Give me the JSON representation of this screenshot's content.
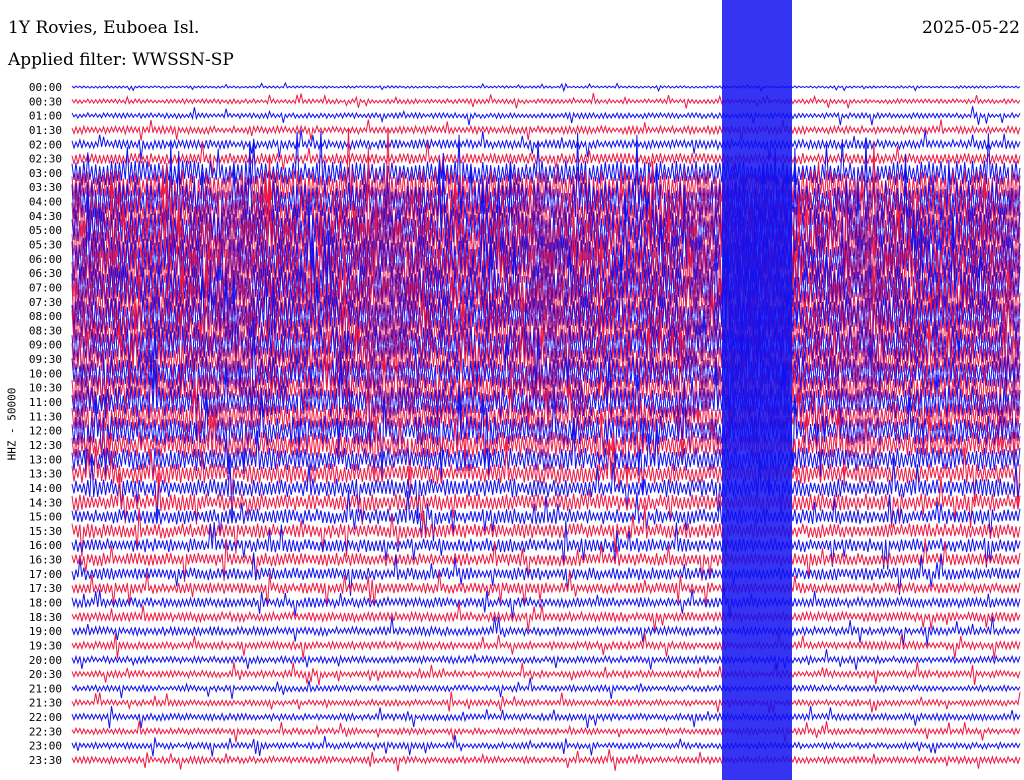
{
  "header": {
    "station": "1Y Rovies, Euboea Isl.",
    "filter": "Applied filter: WWSSN-SP",
    "date": "2025-05-22"
  },
  "channel_label": "HHZ - 50000",
  "colors": {
    "trace_a": "#1010f0",
    "trace_b": "#f01840",
    "background": "#ffffff",
    "text": "#000000"
  },
  "chart_data": {
    "type": "helicorder",
    "time_labels": [
      "00:00",
      "00:30",
      "01:00",
      "01:30",
      "02:00",
      "02:30",
      "03:00",
      "03:30",
      "04:00",
      "04:30",
      "05:00",
      "05:30",
      "06:00",
      "06:30",
      "07:00",
      "07:30",
      "08:00",
      "08:30",
      "09:00",
      "09:30",
      "10:00",
      "10:30",
      "11:00",
      "11:30",
      "12:00",
      "12:30",
      "13:00",
      "13:30",
      "14:00",
      "14:30",
      "15:00",
      "15:30",
      "16:00",
      "16:30",
      "17:00",
      "17:30",
      "18:00",
      "18:30",
      "19:00",
      "19:30",
      "20:00",
      "20:30",
      "21:00",
      "21:30",
      "22:00",
      "22:30",
      "23:00",
      "23:30"
    ],
    "trace_colors": [
      "blue",
      "red"
    ],
    "relative_amplitude_by_row": [
      0.15,
      0.3,
      0.35,
      0.5,
      0.6,
      0.7,
      1.6,
      2.2,
      2.6,
      2.8,
      3.0,
      3.0,
      3.0,
      3.0,
      2.9,
      2.8,
      2.7,
      2.6,
      2.5,
      2.4,
      2.3,
      2.2,
      2.1,
      2.0,
      1.9,
      1.7,
      1.5,
      1.3,
      1.2,
      1.1,
      1.0,
      0.95,
      0.9,
      0.85,
      0.8,
      0.7,
      0.65,
      0.6,
      0.55,
      0.5,
      0.45,
      0.45,
      0.4,
      0.4,
      0.45,
      0.4,
      0.4,
      0.45
    ]
  }
}
